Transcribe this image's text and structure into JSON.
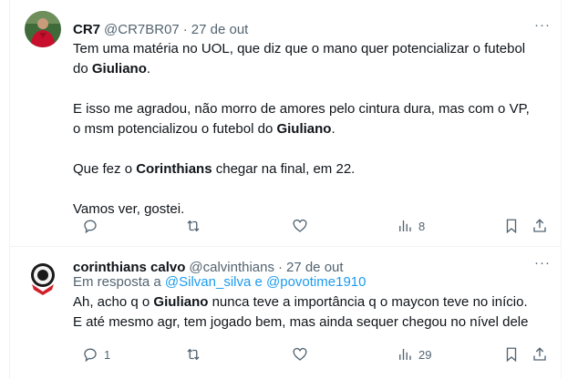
{
  "tweet1": {
    "name": "CR7",
    "handle": "@CR7BR07",
    "date": "27 de out",
    "more": "···",
    "line1a": "Tem uma matéria no UOL, que diz que o mano quer potencializar o futebol",
    "line1b_pre": "do ",
    "line1b_bold": "Giuliano",
    "line1b_post": ".",
    "line2a": "E isso me agradou, não morro de amores pelo cintura dura, mas com o VP,",
    "line2b_pre": "o msm potencializou o futebol do ",
    "line2b_bold": "Giuliano",
    "line2b_post": ".",
    "line3_pre": "Que fez o ",
    "line3_bold": "Corinthians",
    "line3_post": " chegar na final, em 22.",
    "line4": "Vamos ver, gostei.",
    "views": "8",
    "avatar_colors": {
      "bg": "#3f6b3a",
      "shirt": "#c8102e"
    }
  },
  "tweet2": {
    "name": "corinthians calvo",
    "handle": "@calvinthians",
    "date": "27 de out",
    "more": "···",
    "reply_prefix": "Em resposta a ",
    "reply_user1": "@Silvan_silva",
    "reply_and": " e ",
    "reply_user2": "@povotime1910",
    "line1_pre": "Ah, acho q o ",
    "line1_bold": "Giuliano",
    "line1_post": " nunca teve a importância q o maycon teve no início.",
    "line2": "E até mesmo agr, tem jogado bem, mas ainda sequer chegou no nível dele",
    "replies": "1",
    "views": "29"
  },
  "colors": {
    "text": "#0f1419",
    "muted": "#536471",
    "link": "#1d9bf0",
    "border": "#eff3f4"
  }
}
